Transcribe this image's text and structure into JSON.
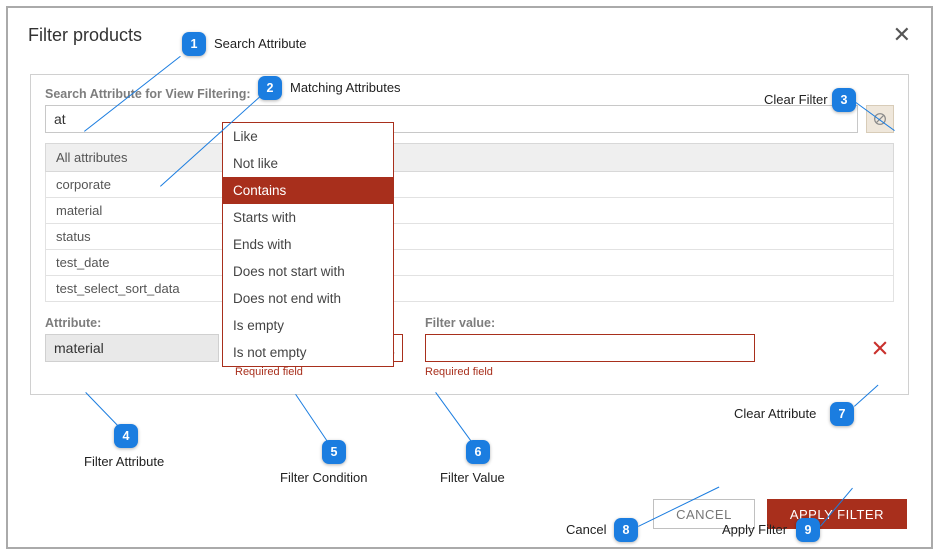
{
  "header": {
    "title": "Filter products"
  },
  "search": {
    "label": "Search Attribute for View Filtering:",
    "value": "at"
  },
  "attributes_header": "All attributes",
  "attributes": [
    "corporate",
    "material",
    "status",
    "test_date",
    "test_select_sort_data"
  ],
  "fields": {
    "attribute_label": "Attribute:",
    "attribute_value": "material",
    "condition_label": "",
    "condition_value": "",
    "value_label": "Filter value:",
    "value_value": "",
    "required": "Required field"
  },
  "dropdown": {
    "items": [
      "Like",
      "Not like",
      "Contains",
      "Starts with",
      "Ends with",
      "Does not start with",
      "Does not end with",
      "Is empty",
      "Is not empty"
    ],
    "selected_index": 2
  },
  "buttons": {
    "cancel": "CANCEL",
    "apply": "APPLY FILTER"
  },
  "callouts": {
    "c1": "Search Attribute",
    "c2": "Matching Attributes",
    "c3": "Clear Filter",
    "c4": "Filter Attribute",
    "c5": "Filter Condition",
    "c6": "Filter Value",
    "c7": "Clear Attribute",
    "c8": "Cancel",
    "c9": "Apply Filter"
  }
}
